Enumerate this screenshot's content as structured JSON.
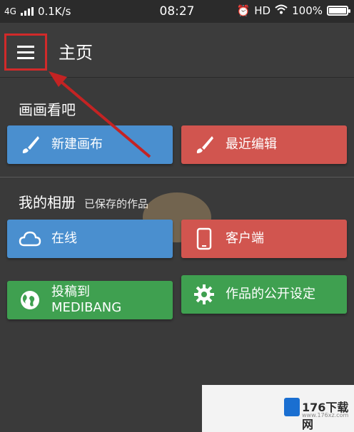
{
  "status_bar": {
    "network": "4G",
    "speed": "0.1K/s",
    "time": "08:27",
    "hd": "HD",
    "battery": "100%"
  },
  "app_bar": {
    "title": "主页"
  },
  "section_canvas": {
    "title": "画画看吧",
    "buttons": [
      {
        "label": "新建画布",
        "icon": "brush-icon",
        "color": "#4a8fcf"
      },
      {
        "label": "最近编辑",
        "icon": "brush-icon",
        "color": "#d1554f"
      }
    ]
  },
  "section_album": {
    "title": "我的相册",
    "subtitle": "已保存的作品",
    "buttons": [
      {
        "label": "在线",
        "icon": "cloud-icon",
        "color": "#4a8fcf"
      },
      {
        "label": "客户端",
        "icon": "phone-icon",
        "color": "#d1554f"
      },
      {
        "label": "投稿到\nMEDIBANG",
        "label_line1": "投稿到",
        "label_line2": "MEDIBANG",
        "icon": "globe-icon",
        "color": "#3fa050"
      },
      {
        "label": "作品的公开设定",
        "icon": "gear-icon",
        "color": "#3fa050"
      }
    ]
  },
  "watermark": {
    "text": "176下载网",
    "small": "www.176xz.com"
  }
}
